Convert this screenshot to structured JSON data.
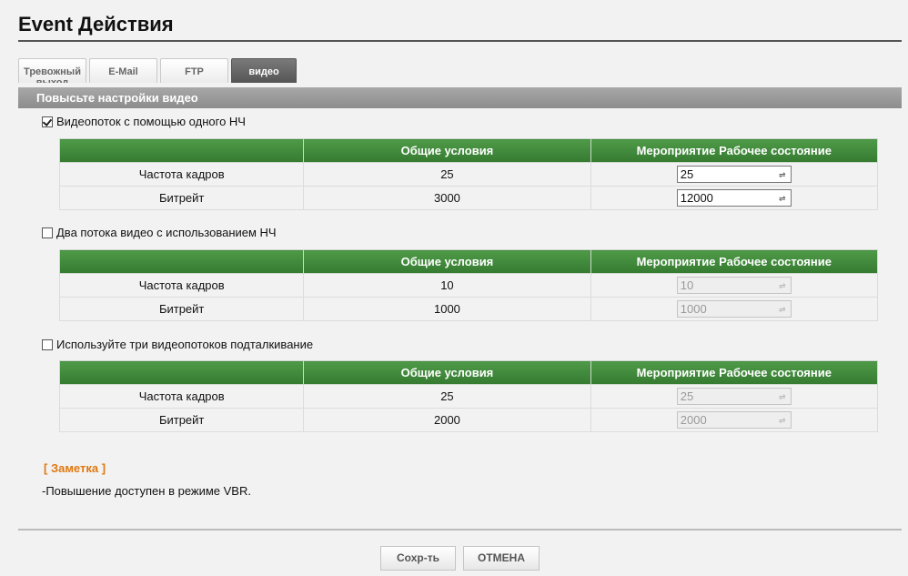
{
  "page": {
    "title": "Event Действия"
  },
  "tabs": [
    {
      "label": "Тревожный выход",
      "active": false
    },
    {
      "label": "E-Mail",
      "active": false
    },
    {
      "label": "FTP",
      "active": false
    },
    {
      "label": "видео",
      "active": true
    }
  ],
  "section": {
    "header": "Повысьте настройки видео"
  },
  "headers": {
    "col1": "",
    "col2": "Общие условия",
    "col3": "Мероприятие Рабочее состояние"
  },
  "options": [
    {
      "label": "Видеопоток с помощью одного НЧ",
      "checked": true,
      "rows": [
        {
          "label": "Частота кадров",
          "general": "25",
          "event": "25",
          "enabled": true
        },
        {
          "label": "Битрейт",
          "general": "3000",
          "event": "12000",
          "enabled": true
        }
      ]
    },
    {
      "label": "Два потока видео с использованием НЧ",
      "checked": false,
      "rows": [
        {
          "label": "Частота кадров",
          "general": "10",
          "event": "10",
          "enabled": false
        },
        {
          "label": "Битрейт",
          "general": "1000",
          "event": "1000",
          "enabled": false
        }
      ]
    },
    {
      "label": "Используйте три видеопотоков подталкивание",
      "checked": false,
      "rows": [
        {
          "label": "Частота кадров",
          "general": "25",
          "event": "25",
          "enabled": false
        },
        {
          "label": "Битрейт",
          "general": "2000",
          "event": "2000",
          "enabled": false
        }
      ]
    }
  ],
  "note": {
    "title": "[ Заметка ]",
    "text": "-Повышение доступен в режиме VBR."
  },
  "buttons": {
    "save": "Сохр-ть",
    "cancel": "ОТМЕНА"
  },
  "icons": {
    "spin": "spin-arrows-icon"
  }
}
